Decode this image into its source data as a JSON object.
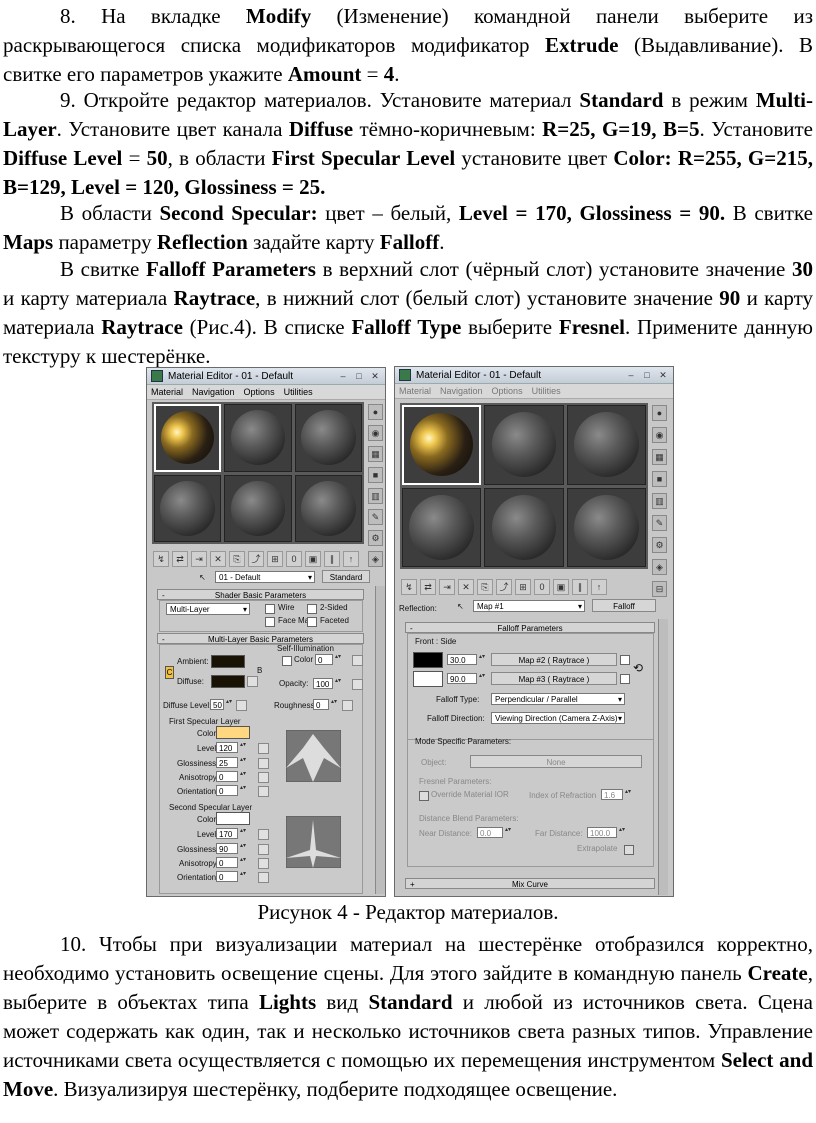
{
  "text": {
    "p8_1": "8. На вкладке ",
    "p8_b1": "Modify",
    "p8_2": " (Изменение) командной панели выберите из раскрывающегося списка модификаторов модификатор ",
    "p8_b2": "Extrude",
    "p8_3": " (Выдавливание). В свитке его параметров укажите ",
    "p8_b3": "Amount",
    "p8_4": " = ",
    "p8_b4": "4",
    "p8_5": ".",
    "p9_1": "9. Откройте редактор материалов. Установите материал ",
    "p9_b1": "Standard",
    "p9_2": " в режим ",
    "p9_b2": "Multi-Layer",
    "p9_3": ". Установите цвет канала ",
    "p9_b3": "Diffuse",
    "p9_4": " тёмно-коричневым: ",
    "p9_b4": "R=25, G=19, B=5",
    "p9_5": ". Установите ",
    "p9_b5": "Diffuse Level",
    "p9_6": " = ",
    "p9_b6": "50",
    "p9_7": ", в области ",
    "p9_b7": "First Specular Level",
    "p9_8": " установите цвет ",
    "p9_b8": "Color: R=255, G=215, B=129, Level = 120, Glossiness = 25.",
    "pa_1": "В области ",
    "pa_b1": "Second Specular:",
    "pa_2": " цвет – белый, ",
    "pa_b2": "Level = 170, Glossiness = 90.",
    "pa_3": " В свитке ",
    "pa_b3": "Maps",
    "pa_4": " параметру ",
    "pa_b4": "Reflection",
    "pa_5": " задайте карту ",
    "pa_b5": "Falloff",
    "pa_6": ".",
    "pb_1": "В свитке ",
    "pb_b1": "Falloff Parameters",
    "pb_2": " в верхний слот (чёрный слот) установите значение ",
    "pb_b2": "30",
    "pb_3": " и карту материала ",
    "pb_b3": "Raytrace",
    "pb_4": ", в нижний слот (белый слот) установите значение ",
    "pb_b4": "90",
    "pb_5": " и карту материала ",
    "pb_b5": "Raytrace",
    "pb_6": " (Рис.4). В списке ",
    "pb_b6": "Falloff Type",
    "pb_7": " выберите ",
    "pb_b7": "Fresnel",
    "pb_8": ". Примените данную текстуру к шестерёнке.",
    "caption": "Рисунок 4 - Редактор материалов.",
    "p10_1": "10. Чтобы при визуализации материал на шестерёнке отобразился корректно, необходимо установить освещение сцены. Для этого зайдите в командную панель ",
    "p10_b1": "Create",
    "p10_2": ", выберите в объектах типа ",
    "p10_b2": "Lights",
    "p10_3": " вид ",
    "p10_b3": "Standard",
    "p10_4": " и любой из источников света. Сцена может содержать как один, так и несколько источников света разных типов. Управление источниками света осуществляется с помощью их перемещения инструментом ",
    "p10_b4": "Select and Move",
    "p10_5": ". Визуализируя шестерёнку, подберите подходящее освещение."
  },
  "left_window": {
    "title": "Material Editor - 01 - Default",
    "menu": [
      "Material",
      "Navigation",
      "Options",
      "Utilities"
    ],
    "material_name": "01 - Default",
    "type_button": "Standard",
    "shader_header": "Shader Basic Parameters",
    "shader": "Multi-Layer",
    "wire": "Wire",
    "two_sided": "2-Sided",
    "face_map": "Face Map",
    "faceted": "Faceted",
    "ml_header": "Multi-Layer Basic Parameters",
    "self_illum": "Self-Illumination",
    "color_label": "Color",
    "self_illum_value": "0",
    "ambient": "Ambient:",
    "diffuse": "Diffuse:",
    "opacity": "Opacity:",
    "opacity_value": "100",
    "diffuse_level": "Diffuse Level:",
    "diffuse_level_value": "50",
    "roughness": "Roughness:",
    "roughness_value": "0",
    "first_layer": "First Specular Layer",
    "second_layer": "Second Specular Layer",
    "color": "Color:",
    "level": "Level:",
    "glossiness": "Glossiness:",
    "anisotropy": "Anisotropy:",
    "orientation": "Orientation:",
    "first_level": "120",
    "first_gloss": "25",
    "first_aniso": "0",
    "first_orient": "0",
    "second_level": "170",
    "second_gloss": "90",
    "second_aniso": "0",
    "second_orient": "0",
    "letter_c": "C",
    "letter_b": "B",
    "first_color": "#ffd781",
    "second_color": "#ffffff",
    "diffuse_color": "#191305"
  },
  "right_window": {
    "title": "Material Editor - 01 - Default",
    "menu": [
      "Material",
      "Navigation",
      "Options",
      "Utilities"
    ],
    "reflection_label": "Reflection:",
    "map_name": "Map #1",
    "type_button": "Falloff",
    "falloff_header": "Falloff Parameters",
    "front_side": "Front : Side",
    "top_value": "30.0",
    "bottom_value": "90.0",
    "map2": "Map #2  ( Raytrace )",
    "map3": "Map #3  ( Raytrace )",
    "falloff_type_label": "Falloff Type:",
    "falloff_type": "Perpendicular / Parallel",
    "falloff_dir_label": "Falloff Direction:",
    "falloff_dir": "Viewing Direction (Camera Z-Axis)",
    "mode_specific": "Mode Specific Parameters:",
    "object_label": "Object:",
    "object_value": "None",
    "fresnel_params": "Fresnel Parameters:",
    "override_ior": "Override Material IOR",
    "ior_label": "Index of Refraction",
    "ior_value": "1.6",
    "distance_blend": "Distance Blend Parameters:",
    "near": "Near Distance:",
    "near_value": "0.0",
    "far": "Far Distance:",
    "far_value": "100.0",
    "extrapolate": "Extrapolate",
    "mix_curve": "Mix Curve"
  }
}
